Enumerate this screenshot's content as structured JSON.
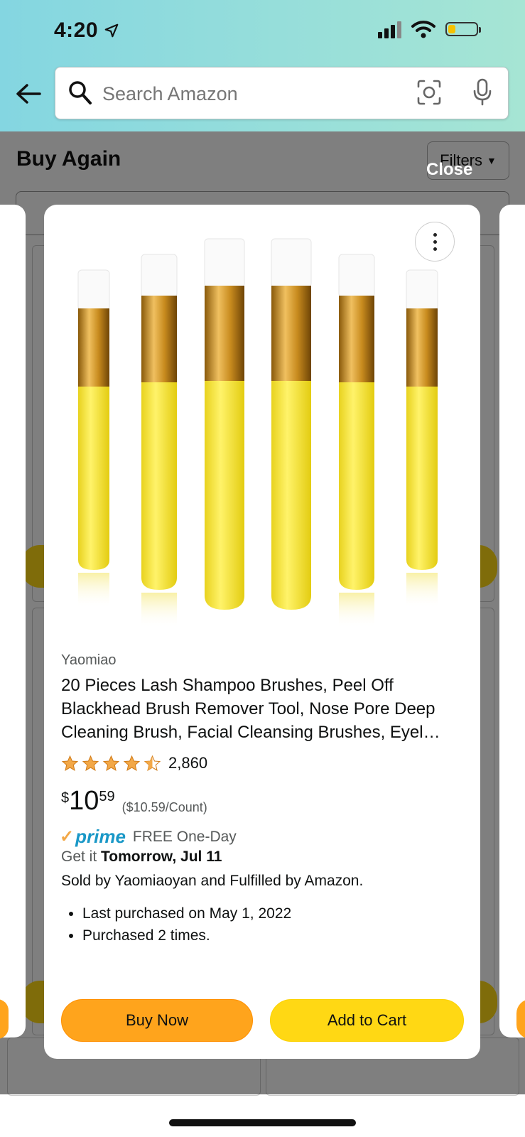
{
  "status_bar": {
    "time": "4:20"
  },
  "search": {
    "placeholder": "Search Amazon"
  },
  "background_page": {
    "title": "Buy Again",
    "filters_label": "Filters"
  },
  "modal": {
    "close_label": "Close",
    "product": {
      "brand": "Yaomiao",
      "title": "20 Pieces Lash Shampoo Brushes, Peel Off Blackhead Brush Remover Tool, Nose Pore Deep Cleaning Brush, Facial Cleansing Brushes, Eyel…",
      "rating": 4.5,
      "rating_count": "2,860",
      "price_symbol": "$",
      "price_whole": "10",
      "price_fraction": "59",
      "unit_price": "($10.59/Count)",
      "prime_label": "prime",
      "shipping": "FREE One-Day",
      "delivery_prefix": "Get it",
      "delivery_date": "Tomorrow, Jul 11",
      "sold_by": "Sold by Yaomiaoyan and Fulfilled by Amazon.",
      "bullets": [
        "Last purchased on May 1, 2022",
        "Purchased 2 times."
      ]
    },
    "buttons": {
      "buy_now": "Buy Now",
      "add_to_cart": "Add to Cart"
    }
  },
  "colors": {
    "header_gradient_start": "#84d6e1",
    "header_gradient_end": "#a6e5d4",
    "buy_now": "#ffa41c",
    "add_to_cart": "#ffd814",
    "prime_blue": "#1a98c7",
    "star": "#f3a847"
  },
  "icons": [
    "back-arrow-icon",
    "search-icon",
    "camera-lens-icon",
    "microphone-icon",
    "more-options-icon",
    "star-icon",
    "prime-check-icon"
  ]
}
